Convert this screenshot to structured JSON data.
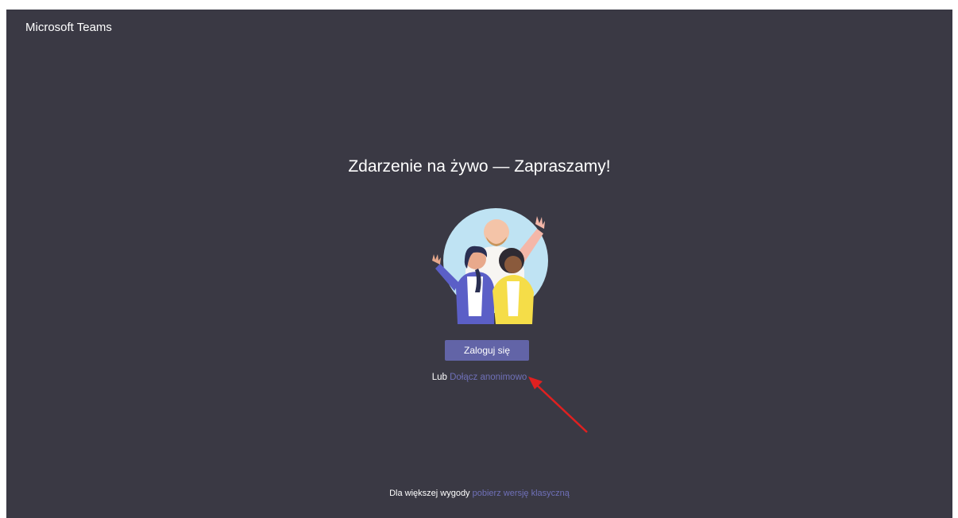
{
  "app": {
    "title": "Microsoft Teams"
  },
  "main": {
    "headline": "Zdarzenie na żywo — Zapraszamy!",
    "illustration_icon": "people-waving-illustration",
    "signin_label": "Zaloguj się",
    "or_label": "Lub",
    "anonymous_link": "Dołącz anonimowo"
  },
  "footer": {
    "prefix": "Dla większej wygody",
    "link": "pobierz wersję klasyczną"
  },
  "colors": {
    "background": "#3a3944",
    "accent": "#6264a7",
    "link": "#6f70b8",
    "annotation_arrow": "#e02020"
  }
}
